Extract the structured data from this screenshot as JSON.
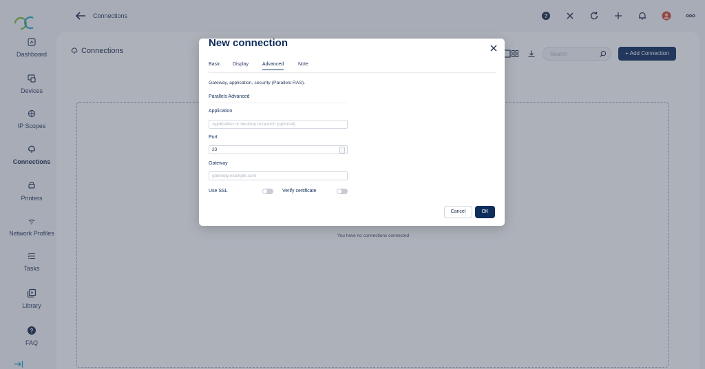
{
  "header": {
    "title": "Connections"
  },
  "sidebar": {
    "items": [
      {
        "label": "Dashboard",
        "icon": "dashboard-icon"
      },
      {
        "label": "Devices",
        "icon": "devices-icon"
      },
      {
        "label": "IP Scopes",
        "icon": "ip-scopes-icon"
      },
      {
        "label": "Connections",
        "icon": "connections-icon",
        "active": true
      },
      {
        "label": "Printers",
        "icon": "printer-icon"
      },
      {
        "label": "Network Profiles",
        "icon": "wifi-icon"
      },
      {
        "label": "Tasks",
        "icon": "tasks-icon"
      },
      {
        "label": "Library",
        "icon": "library-icon"
      },
      {
        "label": "FAQ",
        "icon": "help-icon"
      }
    ]
  },
  "page": {
    "title": "Connections",
    "search_placeholder": "Search",
    "add_button": "+ Add Connection",
    "empty_text": "You have no connections connected"
  },
  "modal": {
    "title": "New connection",
    "tabs": [
      {
        "label": "Basic"
      },
      {
        "label": "Display"
      },
      {
        "label": "Advanced",
        "active": true
      },
      {
        "label": "Note"
      }
    ],
    "description": "Gateway, application, security (Parallels RAS).",
    "section_title": "Parallels Advanced",
    "application": {
      "label": "Application",
      "placeholder": "Application or desktop to launch (optional)",
      "value": ""
    },
    "port": {
      "label": "Port",
      "value": "23"
    },
    "gateway": {
      "label": "Gateway",
      "placeholder": "gateway.example.com",
      "value": ""
    },
    "use_ssl": {
      "label": "Use SSL",
      "checked": false
    },
    "verify_certificate": {
      "label": "Verify certificate",
      "checked": false
    },
    "cancel_label": "Cancel",
    "ok_label": "OK"
  },
  "colors": {
    "accent": "#0f2d5c",
    "background": "#f4f6f9",
    "avatar": "#d4453a"
  }
}
